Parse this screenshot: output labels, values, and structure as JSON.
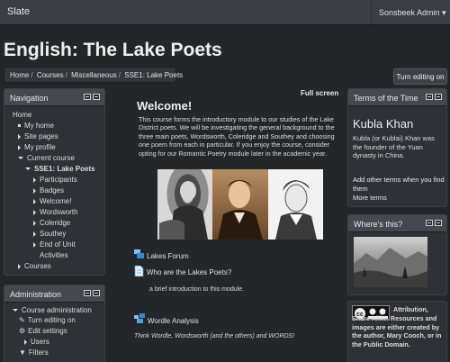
{
  "app": {
    "brand": "Slate",
    "user_menu": "Sonsbeek Admin ▾"
  },
  "page": {
    "title": "English: The Lake Poets"
  },
  "breadcrumb": {
    "items": [
      "Home",
      "Courses",
      "Miscellaneous",
      "SSE1: Lake Poets"
    ]
  },
  "actions": {
    "turn_editing_on": "Turn editing on",
    "full_screen": "Full screen"
  },
  "navigation": {
    "title": "Navigation",
    "items": [
      {
        "label": "Home",
        "marker": "none",
        "bold": false
      },
      {
        "label": "My home",
        "marker": "dot",
        "bold": false
      },
      {
        "label": "Site pages",
        "marker": "right",
        "bold": false
      },
      {
        "label": "My profile",
        "marker": "right",
        "bold": false
      },
      {
        "label": "Current course",
        "marker": "down",
        "bold": false
      },
      {
        "label": "SSE1: Lake Poets",
        "marker": "down",
        "bold": true
      },
      {
        "label": "Participants",
        "marker": "right",
        "bold": false
      },
      {
        "label": "Badges",
        "marker": "right",
        "bold": false
      },
      {
        "label": "Welcome!",
        "marker": "right",
        "bold": false
      },
      {
        "label": "Wordsworth",
        "marker": "right",
        "bold": false
      },
      {
        "label": "Coleridge",
        "marker": "right",
        "bold": false
      },
      {
        "label": "Southey",
        "marker": "right",
        "bold": false
      },
      {
        "label": "End of Unit",
        "marker": "right",
        "bold": false
      },
      {
        "label": "Activities",
        "marker": "none",
        "bold": false
      },
      {
        "label": "Courses",
        "marker": "right",
        "bold": false
      }
    ]
  },
  "administration": {
    "title": "Administration",
    "items": [
      {
        "label": "Course administration",
        "marker": "down",
        "bold": false
      },
      {
        "label": "Turn editing on",
        "marker": "pencil",
        "bold": false
      },
      {
        "label": "Edit settings",
        "marker": "gear",
        "bold": false
      },
      {
        "label": "Users",
        "marker": "right",
        "bold": false
      },
      {
        "label": "Filters",
        "marker": "filter",
        "bold": false
      }
    ]
  },
  "main": {
    "welcome_heading": "Welcome!",
    "intro": "This course forms the introductory module to our studies of the Lake District poets. We will be investigating the  general background to the three main poets, Wordsworth, Coleridge and Southey and choosing one poem from each in particular. If you enjoy the course, consider opting for our Romantic Poetry module later in the academic year.",
    "forum": "Lakes Forum",
    "page_item": "Who are the Lakes Poets?",
    "page_desc": "a brief introduction to this module.",
    "wordle": "Wordle Analysis",
    "wordle_desc": "Think Wordle, Wordsworth (and the others) and WORDS!"
  },
  "terms": {
    "title": "Terms of the Time",
    "term": "Kubla Khan",
    "definition": "Kubla (or Kublai) Khan was the founder of the Yuan dynasty in China.",
    "add_link": "Add other terms when you find them",
    "more_link": "More terms"
  },
  "where": {
    "title": "Where's this?"
  },
  "license": {
    "text": "Attribution, Share Alike. Resources and images are either created by the author, Mary Cooch, or in the Public Domain."
  }
}
